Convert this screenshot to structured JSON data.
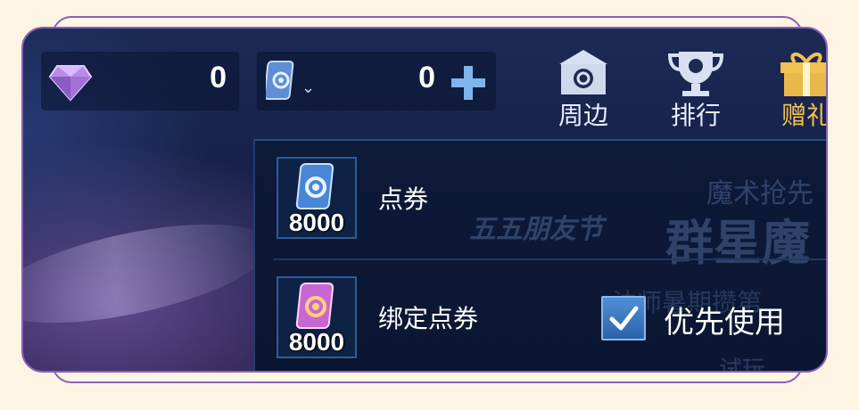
{
  "currency": {
    "diamond": {
      "icon": "diamond-icon",
      "value": "0"
    },
    "coupon": {
      "icon": "coupon-icon",
      "value": "0"
    }
  },
  "nav": [
    {
      "label": "周边",
      "icon": "shop-icon"
    },
    {
      "label": "排行",
      "icon": "trophy-icon"
    },
    {
      "label": "赠礼",
      "icon": "gift-icon"
    }
  ],
  "panel": {
    "background_texts": [
      "魔术抢先",
      "五五朋友节",
      "群星魔",
      "法师暑期攒第",
      "试玩"
    ],
    "rows": [
      {
        "label": "点券",
        "count": "8000",
        "icon": "blue-coupon-icon"
      },
      {
        "label": "绑定点券",
        "count": "8000",
        "icon": "pink-bound-coupon-icon"
      }
    ],
    "priority_use": {
      "label": "优先使用",
      "checked": true
    }
  },
  "colors": {
    "accent": "#4f8fd6",
    "frame": "#8a5fb8",
    "page_bg": "#fdf4e3",
    "gold": "#e8b84a"
  }
}
